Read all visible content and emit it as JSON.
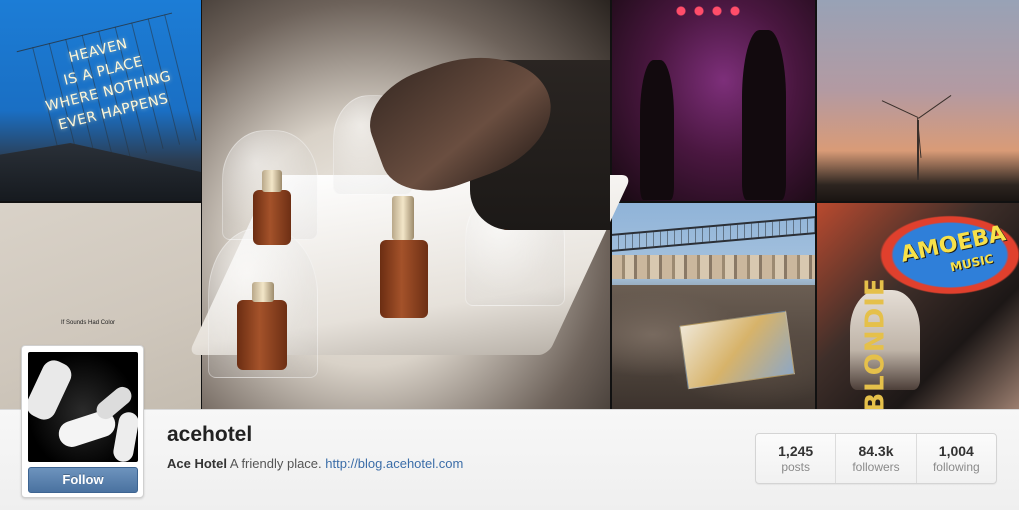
{
  "profile": {
    "username": "acehotel",
    "full_name": "Ace Hotel",
    "bio_text": "A friendly place.",
    "bio_link": "http://blog.acehotel.com",
    "follow_label": "Follow"
  },
  "stats": [
    {
      "value": "1,245",
      "label": "posts"
    },
    {
      "value": "84.3k",
      "label": "followers"
    },
    {
      "value": "1,004",
      "label": "following"
    }
  ],
  "mosaic": {
    "sign_lines": [
      "HEAVEN",
      "IS A PLACE",
      "WHERE NOTHING",
      "EVER HAPPENS"
    ],
    "wall_caption": "If Sounds Had Color",
    "poster_title": "AMOEBA",
    "poster_subtitle": "MUSIC",
    "poster_band": "BLONDIE"
  },
  "colors": {
    "follow_button": "#4a72a0",
    "link": "#3b6da8",
    "sign_sky": "#1c7dd6"
  }
}
